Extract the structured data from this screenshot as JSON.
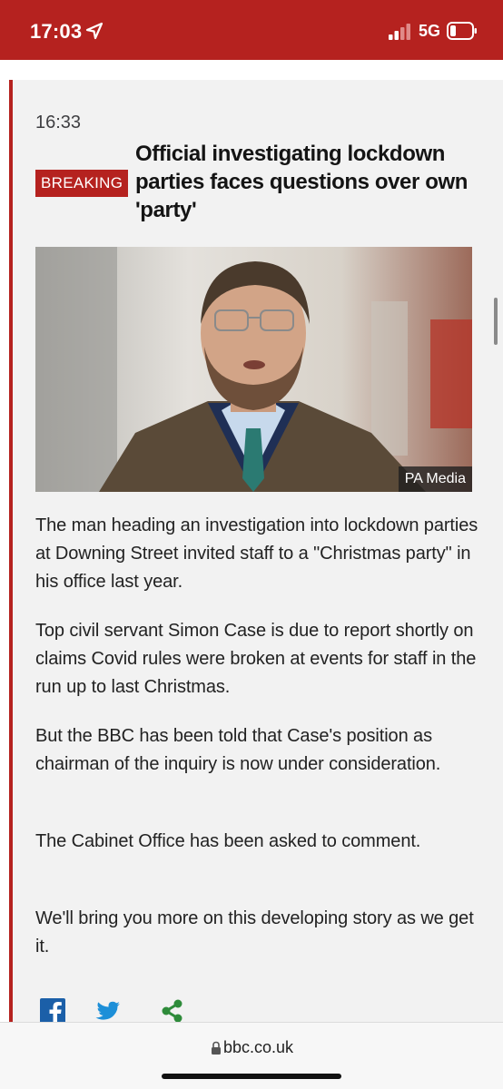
{
  "status_bar": {
    "time": "17:03",
    "network": "5G",
    "icons": [
      "location-arrow-icon",
      "signal-icon",
      "battery-icon"
    ],
    "background_color": "#b5221f"
  },
  "post": {
    "time": "16:33",
    "badge": "BREAKING",
    "headline": "Official investigating lockdown parties faces questions over own 'party'",
    "image_credit": "PA Media",
    "paragraphs": [
      "The man heading an investigation into lockdown parties at Downing Street invited staff to a \"Christmas party\" in his office last year.",
      "Top civil servant Simon Case is due to report shortly on claims Covid rules were broken at events for staff in the run up to last Christmas.",
      "But the BBC has been told that Case's position as chairman of the inquiry is now under consideration.",
      "The Cabinet Office has been asked to comment.",
      "We'll bring you more on this developing story as we get it."
    ],
    "share_icons": [
      "facebook-icon",
      "twitter-icon",
      "share-icon"
    ],
    "accent_color": "#b5221f"
  },
  "url_bar": {
    "url": "bbc.co.uk",
    "icon": "lock-icon"
  }
}
